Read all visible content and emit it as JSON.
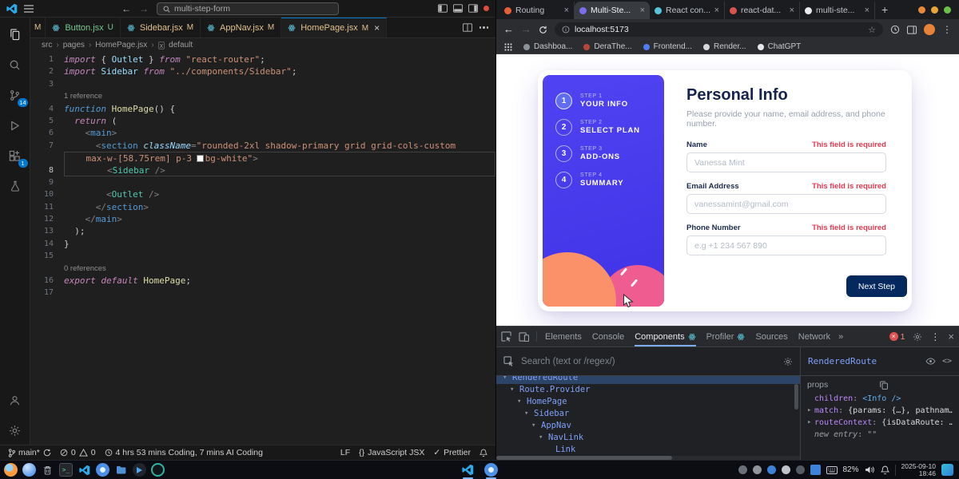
{
  "vscode": {
    "title_search": "multi-step-form",
    "activity": {
      "scm_badge": "14",
      "ext_badge": "1"
    },
    "tab_stub": "M",
    "tabs": [
      {
        "label": "Button.jsx",
        "badge": "U",
        "active": false
      },
      {
        "label": "Sidebar.jsx",
        "badge": "M",
        "active": false
      },
      {
        "label": "AppNav.jsx",
        "badge": "M",
        "active": false
      },
      {
        "label": "HomePage.jsx",
        "badge": "M",
        "active": true
      }
    ],
    "breadcrumb": {
      "parts": [
        "src",
        "pages",
        "HomePage.jsx"
      ],
      "symbol": "default"
    },
    "code": {
      "rows": [
        {
          "n": "1",
          "t": [
            [
              "kw",
              "import"
            ],
            [
              "pl",
              " { "
            ],
            [
              "vr",
              "Outlet"
            ],
            [
              "pl",
              " } "
            ],
            [
              "kw",
              "from"
            ],
            [
              "pl",
              " "
            ],
            [
              "st",
              "\"react-router\""
            ],
            [
              "pl",
              ";"
            ]
          ]
        },
        {
          "n": "2",
          "t": [
            [
              "kw",
              "import"
            ],
            [
              "pl",
              " "
            ],
            [
              "vr",
              "Sidebar"
            ],
            [
              "pl",
              " "
            ],
            [
              "kw",
              "from"
            ],
            [
              "pl",
              " "
            ],
            [
              "st",
              "\"../components/Sidebar\""
            ],
            [
              "pl",
              ";"
            ]
          ]
        },
        {
          "n": "3",
          "t": []
        },
        {
          "lens": true,
          "t": [
            [
              "ln",
              "1 reference"
            ]
          ]
        },
        {
          "n": "4",
          "t": [
            [
              "kw2",
              "function"
            ],
            [
              "pl",
              " "
            ],
            [
              "fn",
              "HomePage"
            ],
            [
              "pl",
              "() {"
            ]
          ]
        },
        {
          "n": "5",
          "t": [
            [
              "pl",
              "  "
            ],
            [
              "kw",
              "return"
            ],
            [
              "pl",
              " ("
            ]
          ]
        },
        {
          "n": "6",
          "t": [
            [
              "pl",
              "    "
            ],
            [
              "pu",
              "<"
            ],
            [
              "tg",
              "main"
            ],
            [
              "pu",
              ">"
            ]
          ]
        },
        {
          "n": "7",
          "t": [
            [
              "pl",
              "      "
            ],
            [
              "pu",
              "<"
            ],
            [
              "tg",
              "section"
            ],
            [
              "pl",
              " "
            ],
            [
              "at",
              "className"
            ],
            [
              "pu",
              "="
            ],
            [
              "st",
              "\"rounded-2xl shadow-primary grid grid-cols-custom"
            ]
          ]
        },
        {
          "n": "",
          "hl": "first",
          "t": [
            [
              "pl",
              "    "
            ],
            [
              "st",
              "max-w-[58.75rem] p-3 "
            ],
            [
              "sw",
              ""
            ],
            [
              "st",
              "bg-white\""
            ],
            [
              "pu",
              ">"
            ]
          ]
        },
        {
          "n": "8",
          "hl": "last",
          "t": [
            [
              "pl",
              "        "
            ],
            [
              "pu",
              "<"
            ],
            [
              "cp",
              "Sidebar"
            ],
            [
              "pl",
              " "
            ],
            [
              "pu",
              "/>"
            ]
          ]
        },
        {
          "n": "9",
          "t": []
        },
        {
          "n": "10",
          "t": [
            [
              "pl",
              "        "
            ],
            [
              "pu",
              "<"
            ],
            [
              "cp",
              "Outlet"
            ],
            [
              "pl",
              " "
            ],
            [
              "pu",
              "/>"
            ]
          ]
        },
        {
          "n": "11",
          "t": [
            [
              "pl",
              "      "
            ],
            [
              "pu",
              "</"
            ],
            [
              "tg",
              "section"
            ],
            [
              "pu",
              ">"
            ]
          ]
        },
        {
          "n": "12",
          "t": [
            [
              "pl",
              "    "
            ],
            [
              "pu",
              "</"
            ],
            [
              "tg",
              "main"
            ],
            [
              "pu",
              ">"
            ]
          ]
        },
        {
          "n": "13",
          "t": [
            [
              "pl",
              "  );"
            ]
          ]
        },
        {
          "n": "14",
          "t": [
            [
              "pl",
              "}"
            ]
          ]
        },
        {
          "n": "15",
          "t": []
        },
        {
          "lens": true,
          "t": [
            [
              "ln",
              "0 references"
            ]
          ]
        },
        {
          "n": "16",
          "t": [
            [
              "kw",
              "export"
            ],
            [
              "pl",
              " "
            ],
            [
              "kw",
              "default"
            ],
            [
              "pl",
              " "
            ],
            [
              "fn",
              "HomePage"
            ],
            [
              "pl",
              ";"
            ]
          ]
        },
        {
          "n": "17",
          "t": []
        }
      ]
    },
    "status": {
      "branch": "main*",
      "errors": "0",
      "warnings": "0",
      "timer": "4 hrs 53 mins Coding, 7 mins AI Coding",
      "eol": "LF",
      "braces": "{}",
      "language": "JavaScript JSX",
      "formatter": "Prettier"
    }
  },
  "browser": {
    "url": "localhost:5173",
    "tabs": [
      {
        "label": "Routing",
        "color": "#e45f35",
        "active": false
      },
      {
        "label": "Multi-Ste...",
        "color": "#7c6cf0",
        "active": true
      },
      {
        "label": "React con...",
        "color": "#58c4dc",
        "active": false
      },
      {
        "label": "react-dat...",
        "color": "#d9534f",
        "active": false
      },
      {
        "label": "multi-ste...",
        "color": "#e8eaed",
        "active": false
      }
    ],
    "bookmarks": [
      {
        "label": "Dashboa...",
        "color": "#8d9199"
      },
      {
        "label": "DeraThe...",
        "color": "#b8453c"
      },
      {
        "label": "Frontend...",
        "color": "#4f7df2"
      },
      {
        "label": "Render...",
        "color": "#d5d7db"
      },
      {
        "label": "ChatGPT",
        "color": "#e6e8ea"
      }
    ],
    "page": {
      "title": "Personal Info",
      "subtitle": "Please provide your name, email address, and phone number.",
      "steps": [
        {
          "num": "1",
          "step": "STEP 1",
          "name": "YOUR INFO",
          "active": true
        },
        {
          "num": "2",
          "step": "STEP 2",
          "name": "SELECT PLAN",
          "active": false
        },
        {
          "num": "3",
          "step": "STEP 3",
          "name": "ADD-ONS",
          "active": false
        },
        {
          "num": "4",
          "step": "STEP 4",
          "name": "SUMMARY",
          "active": false
        }
      ],
      "fields": [
        {
          "id": "name",
          "label": "Name",
          "error": "This field is required",
          "placeholder": "Vanessa Mint"
        },
        {
          "id": "email",
          "label": "Email Address",
          "error": "This field is required",
          "placeholder": "vanessamint@gmail.com"
        },
        {
          "id": "phone",
          "label": "Phone Number",
          "error": "This field is required",
          "placeholder": "e.g +1 234 567 890"
        }
      ],
      "next_button": "Next Step"
    },
    "devtools": {
      "tabs": [
        {
          "label": "Elements",
          "active": false,
          "atom": false
        },
        {
          "label": "Console",
          "active": false,
          "atom": false
        },
        {
          "label": "Components",
          "active": true,
          "atom": true
        },
        {
          "label": "Profiler",
          "active": false,
          "atom": true
        },
        {
          "label": "Sources",
          "active": false,
          "atom": false
        },
        {
          "label": "Network",
          "active": false,
          "atom": false
        }
      ],
      "error_count": "1",
      "search_placeholder": "Search (text or /regex/)",
      "tree": [
        {
          "label": "RenderedRoute",
          "indent": 0,
          "caret": true,
          "clipped": true,
          "selected": true
        },
        {
          "label": "Route.Provider",
          "indent": 1,
          "caret": true
        },
        {
          "label": "HomePage",
          "indent": 2,
          "caret": true
        },
        {
          "label": "Sidebar",
          "indent": 3,
          "caret": true
        },
        {
          "label": "AppNav",
          "indent": 4,
          "caret": true
        },
        {
          "label": "NavLink",
          "indent": 5,
          "caret": true
        },
        {
          "label": "Link",
          "indent": 6,
          "caret": false
        }
      ],
      "selected_component": "RenderedRoute",
      "props_label": "props",
      "props": [
        {
          "key": "children",
          "value": "<Info />",
          "caret": false,
          "vclass": "elem"
        },
        {
          "key": "match",
          "value": "{params: {…}, pathnam…",
          "caret": true,
          "vclass": "obj"
        },
        {
          "key": "routeContext",
          "value": "{isDataRoute: …",
          "caret": true,
          "vclass": "obj"
        },
        {
          "key": "new entry",
          "value": "\"\"",
          "caret": false,
          "kclass": "new",
          "vclass": "str"
        }
      ]
    }
  },
  "taskbar": {
    "battery": "82%",
    "date": "2025-09-10",
    "time": "18:46"
  }
}
